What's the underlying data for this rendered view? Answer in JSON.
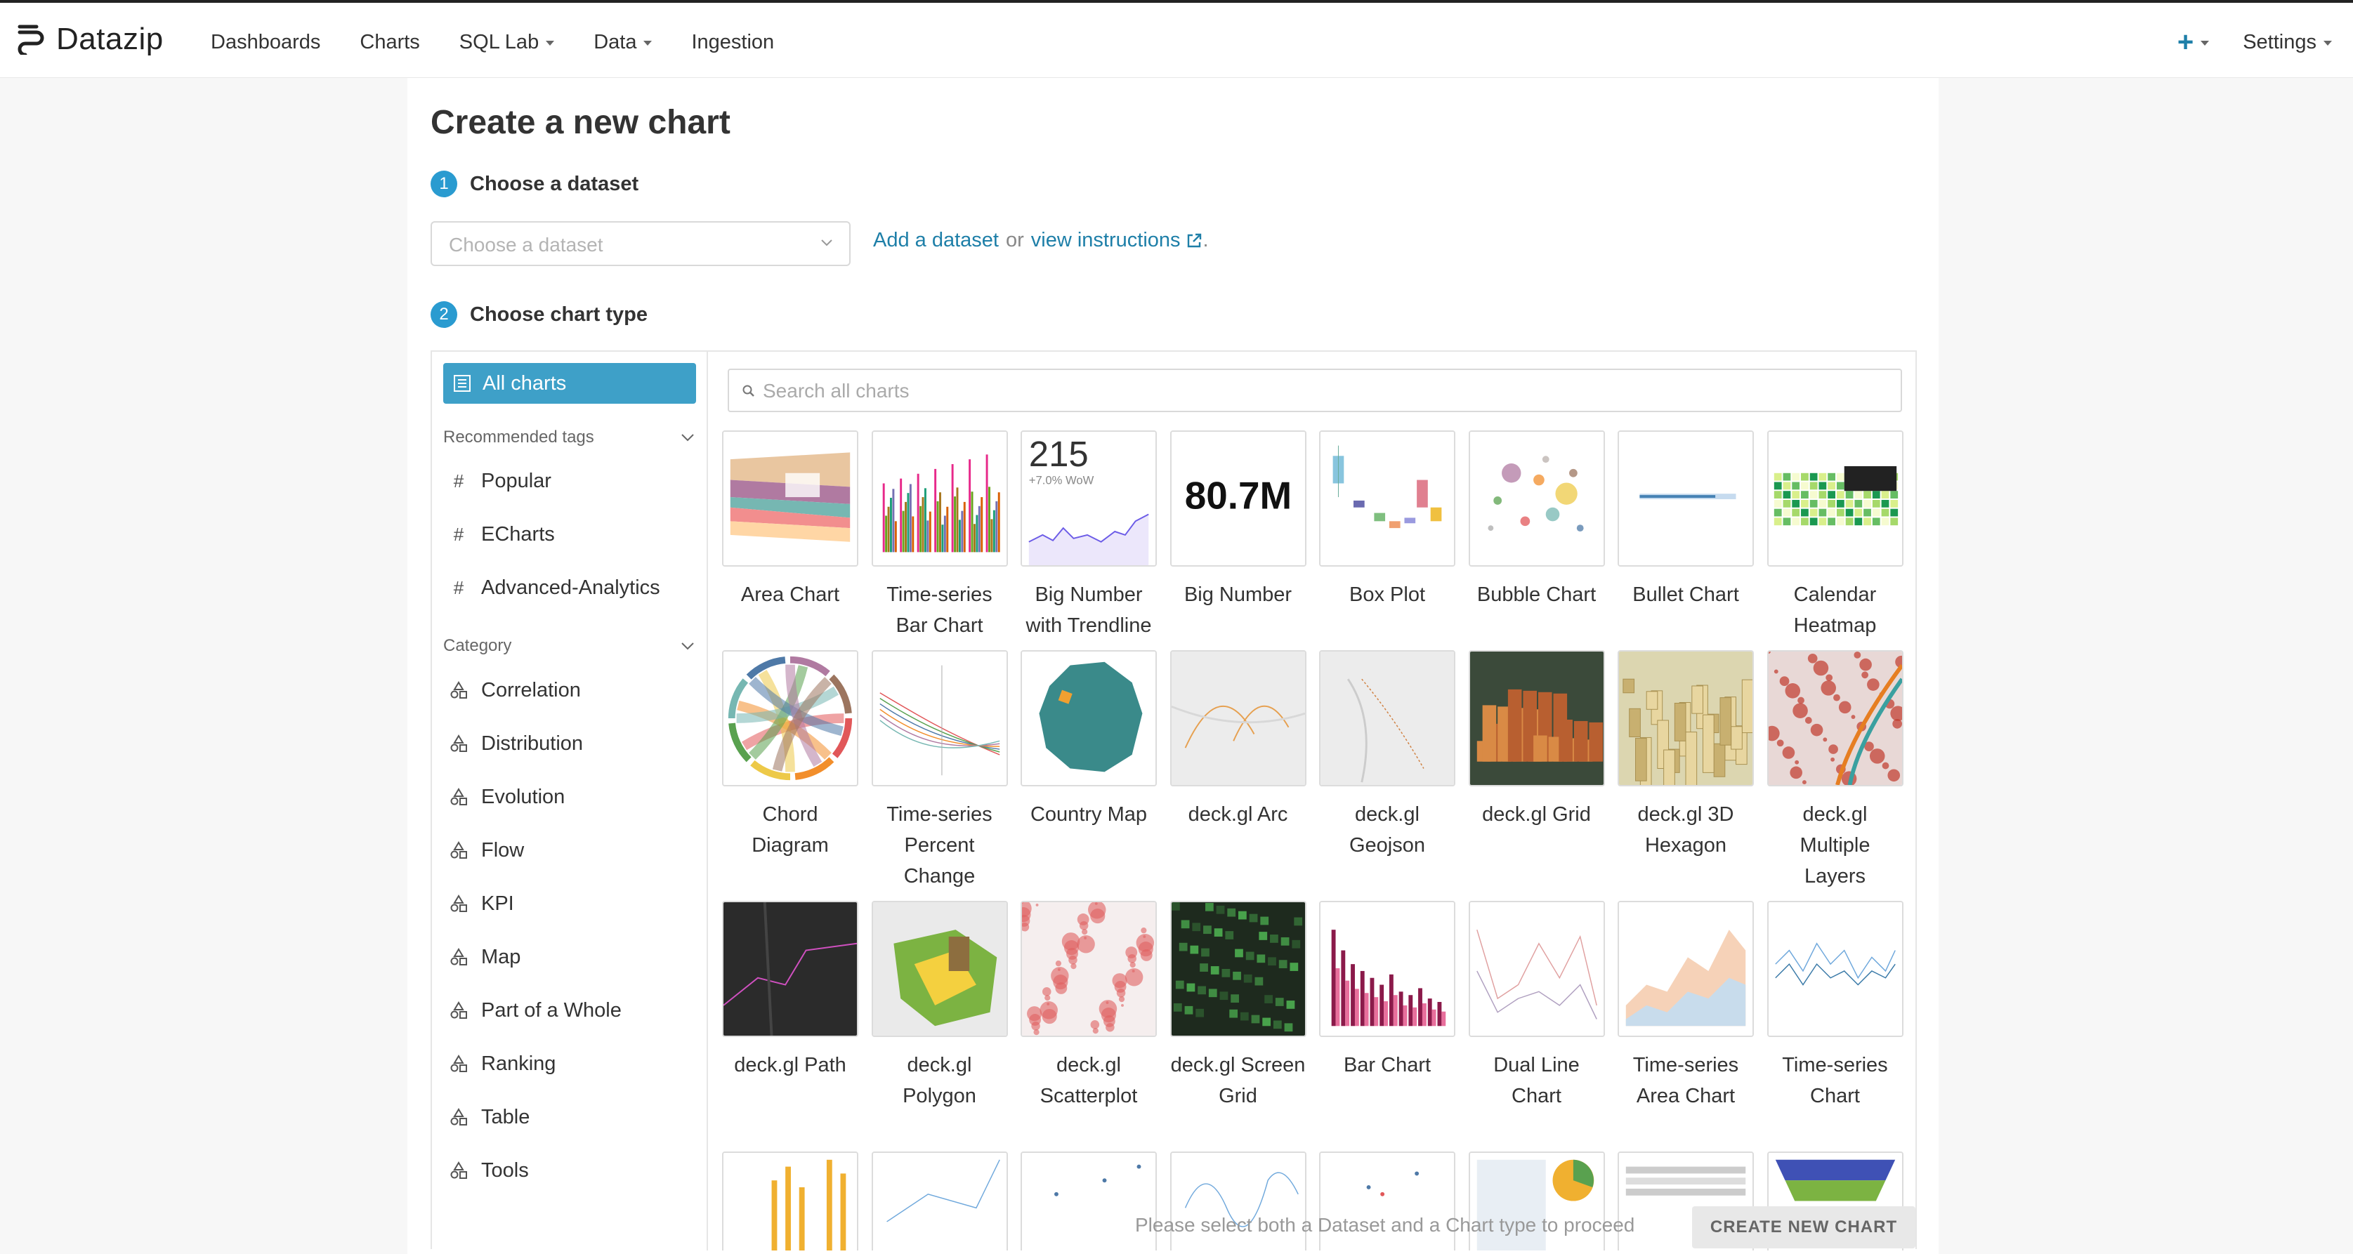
{
  "app": {
    "brand": "Datazip"
  },
  "nav": {
    "items": [
      {
        "label": "Dashboards",
        "dropdown": false
      },
      {
        "label": "Charts",
        "dropdown": false
      },
      {
        "label": "SQL Lab",
        "dropdown": true
      },
      {
        "label": "Data",
        "dropdown": true
      },
      {
        "label": "Ingestion",
        "dropdown": false
      }
    ],
    "plus_icon": "plus-icon",
    "settings_label": "Settings"
  },
  "page": {
    "title": "Create a new chart",
    "step1": {
      "num": "1",
      "label": "Choose a dataset"
    },
    "dataset_placeholder": "Choose a dataset",
    "add_dataset": "Add a dataset",
    "or_text": "or",
    "view_instructions": "view instructions",
    "period": ".",
    "step2": {
      "num": "2",
      "label": "Choose chart type"
    },
    "footer_msg": "Please select both a Dataset and a Chart type to proceed",
    "create_button": "CREATE NEW CHART"
  },
  "sidebar": {
    "all_charts": "All charts",
    "recommended_header": "Recommended tags",
    "tags": [
      "Popular",
      "ECharts",
      "Advanced-Analytics"
    ],
    "category_header": "Category",
    "categories": [
      "Correlation",
      "Distribution",
      "Evolution",
      "Flow",
      "KPI",
      "Map",
      "Part of a Whole",
      "Ranking",
      "Table",
      "Tools"
    ]
  },
  "search": {
    "placeholder": "Search all charts"
  },
  "thumb_text": {
    "big_number_trend": "215",
    "big_number_trend_sub": "+7.0% WoW",
    "big_number": "80.7M"
  },
  "charts": [
    {
      "label": "Area Chart",
      "thumb": "area"
    },
    {
      "label": "Time-series Bar Chart",
      "thumb": "tsbar"
    },
    {
      "label": "Big Number with Trendline",
      "thumb": "bignumtrend"
    },
    {
      "label": "Big Number",
      "thumb": "bignum"
    },
    {
      "label": "Box Plot",
      "thumb": "box"
    },
    {
      "label": "Bubble Chart",
      "thumb": "bubble"
    },
    {
      "label": "Bullet Chart",
      "thumb": "bullet"
    },
    {
      "label": "Calendar Heatmap",
      "thumb": "calendar"
    },
    {
      "label": "Chord Diagram",
      "thumb": "chord"
    },
    {
      "label": "Time-series Percent Change",
      "thumb": "tspercent"
    },
    {
      "label": "Country Map",
      "thumb": "country"
    },
    {
      "label": "deck.gl Arc",
      "thumb": "arc"
    },
    {
      "label": "deck.gl Geojson",
      "thumb": "geojson"
    },
    {
      "label": "deck.gl Grid",
      "thumb": "grid"
    },
    {
      "label": "deck.gl 3D Hexagon",
      "thumb": "hexagon"
    },
    {
      "label": "deck.gl Multiple Layers",
      "thumb": "multilayer"
    },
    {
      "label": "deck.gl Path",
      "thumb": "path"
    },
    {
      "label": "deck.gl Polygon",
      "thumb": "polygon"
    },
    {
      "label": "deck.gl Scatterplot",
      "thumb": "scatter"
    },
    {
      "label": "deck.gl Screen Grid",
      "thumb": "screengrid"
    },
    {
      "label": "Bar Chart",
      "thumb": "bar"
    },
    {
      "label": "Dual Line Chart",
      "thumb": "dualline"
    },
    {
      "label": "Time-series Area Chart",
      "thumb": "tsarea"
    },
    {
      "label": "Time-series Chart",
      "thumb": "tsline"
    },
    {
      "label": "",
      "thumb": "partialbars"
    },
    {
      "label": "",
      "thumb": "partialline"
    },
    {
      "label": "",
      "thumb": "partialdots"
    },
    {
      "label": "",
      "thumb": "partialwave"
    },
    {
      "label": "",
      "thumb": "partialscatter"
    },
    {
      "label": "",
      "thumb": "partialpie"
    },
    {
      "label": "",
      "thumb": "partialtable"
    },
    {
      "label": "",
      "thumb": "partialfunnel"
    }
  ],
  "colors": {
    "accent": "#3ea0c8",
    "link": "#1e7fa8",
    "step": "#2a9bd0"
  }
}
